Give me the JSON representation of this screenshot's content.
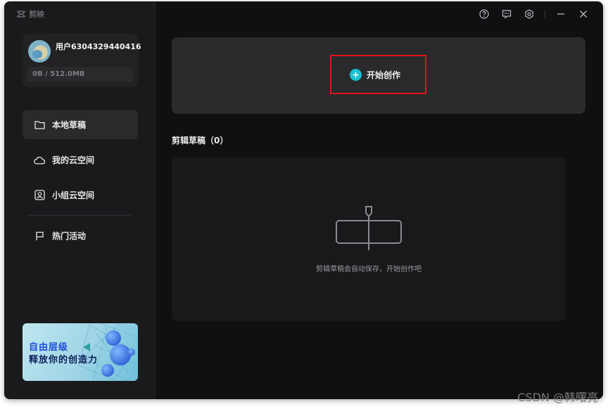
{
  "app": {
    "name": "剪映"
  },
  "user": {
    "name": "用户6304329440416",
    "storage": "0B / 512.0MB"
  },
  "nav": [
    {
      "label": "本地草稿",
      "icon": "folder-icon",
      "active": true
    },
    {
      "label": "我的云空间",
      "icon": "cloud-icon",
      "active": false
    },
    {
      "label": "小组云空间",
      "icon": "group-cloud-icon",
      "active": false
    },
    {
      "label": "热门活动",
      "icon": "flag-icon",
      "active": false
    }
  ],
  "banner": {
    "line1": "自由层级",
    "line2": "释放你的创造力"
  },
  "topbar": {
    "icons": [
      "help-icon",
      "feedback-icon",
      "settings-icon",
      "minimize-icon",
      "close-icon"
    ]
  },
  "create": {
    "label": "开始创作",
    "icon": "plus-icon"
  },
  "drafts": {
    "title": "剪辑草稿（0）",
    "empty_text": "剪辑草稿会自动保存，开始创作吧"
  },
  "watermark": "CSDN @韩曙亮",
  "colors": {
    "accent": "#17c2d0",
    "highlight_border": "#e0141e",
    "background": "#101012",
    "sidebar": "#1a1a1c"
  }
}
